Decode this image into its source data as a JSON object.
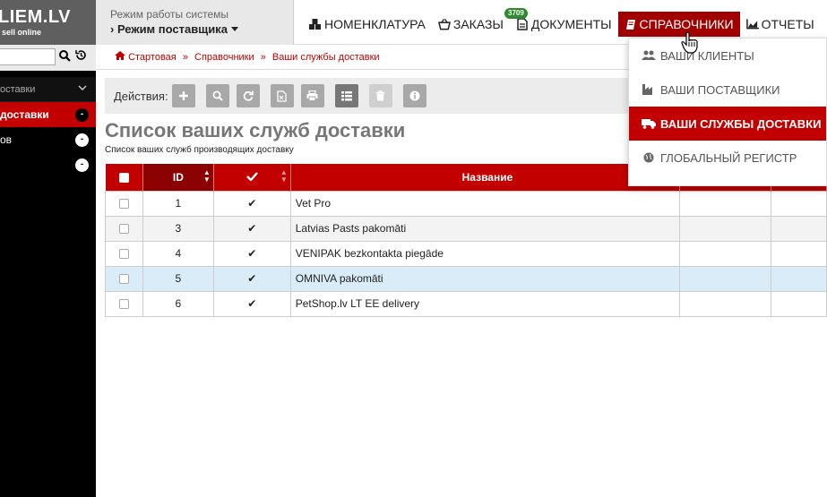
{
  "logo": {
    "brand": "LIEM.LV",
    "tagline": "sell online"
  },
  "mode": {
    "label": "Режим работы системы",
    "value": "› Режим поставщика"
  },
  "topnav": [
    {
      "label": "НОМЕНКЛАТУРА",
      "icon": "cubes-icon"
    },
    {
      "label": "ЗАКАЗЫ",
      "icon": "basket-icon",
      "badge": "3709"
    },
    {
      "label": "ДОКУМЕНТЫ",
      "icon": "document-icon"
    },
    {
      "label": "СПРАВОЧНИКИ",
      "icon": "book-icon",
      "active": true
    },
    {
      "label": "ОТЧЕТЫ",
      "icon": "chart-icon"
    }
  ],
  "dropdown": [
    {
      "label": "Ваши клиенты",
      "icon": "users-icon"
    },
    {
      "label": "Ваши поставщики",
      "icon": "industry-icon"
    },
    {
      "label": "Ваши службы доставки",
      "icon": "truck-icon",
      "active": true
    },
    {
      "label": "Глобальный регистр",
      "icon": "globe-icon"
    }
  ],
  "sidebar": {
    "search_placeholder": "",
    "section": "оставки",
    "items": [
      {
        "label": "доставки",
        "badge": "-",
        "active": true
      },
      {
        "label": "ов",
        "badge": "-"
      },
      {
        "label": "",
        "badge": "-"
      }
    ]
  },
  "breadcrumb": [
    "Стартовая",
    "Справочники",
    "Ваши службы доставки"
  ],
  "actions_label": "Действия:",
  "page": {
    "title": "Список ваших служб доставки",
    "subtitle": "Список ваших служб производящих доставку"
  },
  "table": {
    "headers": {
      "id": "ID",
      "name": "Название"
    },
    "rows": [
      {
        "id": "1",
        "check": "✔",
        "name": "Vet Pro"
      },
      {
        "id": "3",
        "check": "✔",
        "name": "Latvias Pasts pakomāti"
      },
      {
        "id": "4",
        "check": "✔",
        "name": "VENIPAK bezkontakta piegāde"
      },
      {
        "id": "5",
        "check": "✔",
        "name": "OMNIVA pakomāti"
      },
      {
        "id": "6",
        "check": "✔",
        "name": "PetShop.lv LT EE delivery"
      }
    ]
  },
  "colors": {
    "accent": "#c30000",
    "accent_dark": "#a20000",
    "highlight_row": "#d9ecf7"
  }
}
